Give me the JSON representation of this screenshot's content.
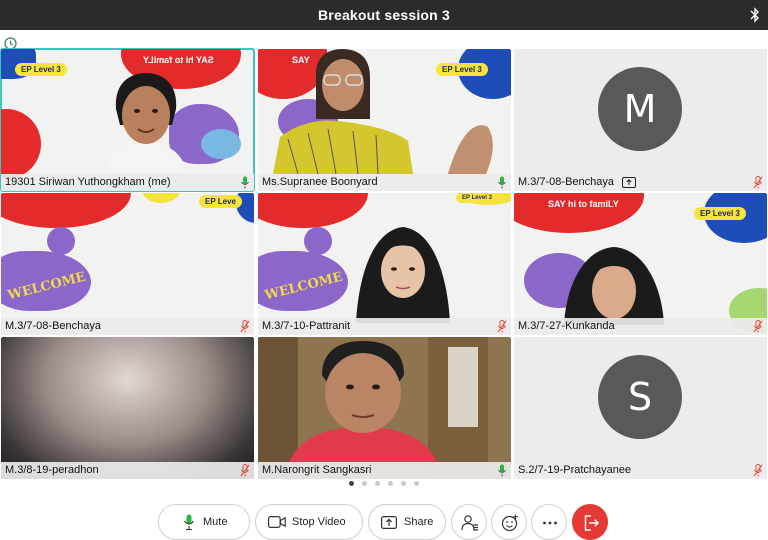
{
  "window": {
    "title": "Breakout session 3"
  },
  "participants": [
    {
      "name": "19301 Siriwan Yuthongkham (me)",
      "mic": "on"
    },
    {
      "name": "Ms.Supranee Boonyard",
      "mic": "on"
    },
    {
      "name": "M.3/7-08-Benchaya",
      "mic": "muted",
      "initial": "M",
      "sharing": true
    },
    {
      "name": "M.3/7-08-Benchaya",
      "mic": "muted"
    },
    {
      "name": "M.3/7-10-Pattranit",
      "mic": "muted"
    },
    {
      "name": "M.3/7-27-Kunkanda",
      "mic": "muted"
    },
    {
      "name": "M.3/8-19-peradhon",
      "mic": "muted"
    },
    {
      "name": "M.Narongrit Sangkasri",
      "mic": "on"
    },
    {
      "name": "S.2/7-19-Pratchayanee",
      "mic": "muted",
      "initial": "S"
    }
  ],
  "background_text": {
    "ep_level": "EP Level 3",
    "say_hi": "SAY hi to famiLY",
    "say_hi_mirrored": "SAY hi to famiLY",
    "welcome": "WELCOME"
  },
  "pager": {
    "pages": 6,
    "current": 1
  },
  "toolbar": {
    "mute_label": "Mute",
    "stop_video_label": "Stop Video",
    "share_label": "Share"
  },
  "colors": {
    "active_border": "#3ec5c0",
    "mic_on": "#2fb344",
    "mic_muted": "#e0533d",
    "leave": "#e53935"
  }
}
